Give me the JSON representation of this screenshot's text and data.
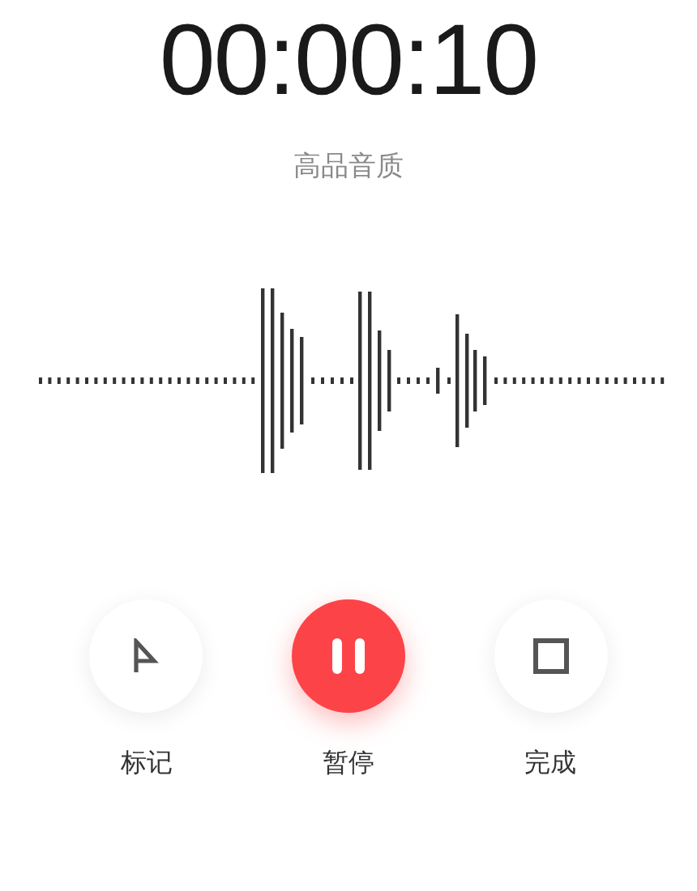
{
  "timer": "00:00:10",
  "quality": "高品音质",
  "controls": [
    {
      "kind": "mark",
      "label": "标记"
    },
    {
      "kind": "pause",
      "label": "暂停"
    },
    {
      "kind": "stop",
      "label": "完成"
    }
  ]
}
